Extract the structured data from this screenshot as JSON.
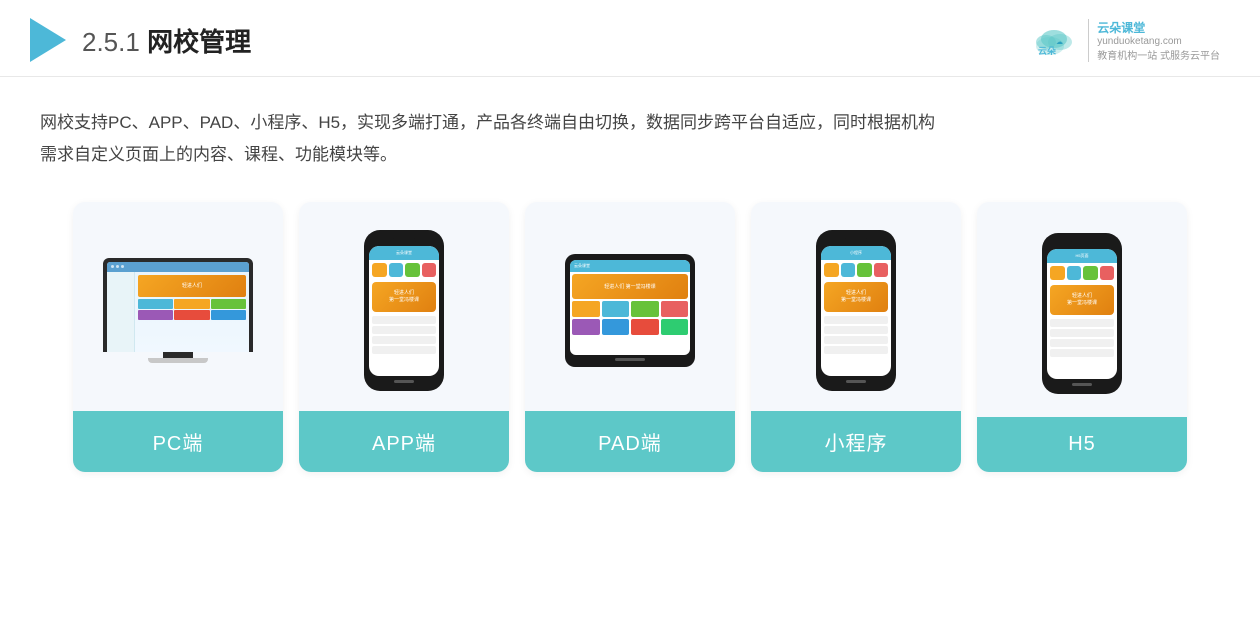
{
  "header": {
    "title_number": "2.5.1",
    "title_text": "网校管理",
    "brand": {
      "name": "云朵课堂",
      "domain": "yunduoketang.com",
      "slogan1": "教育机构一站",
      "slogan2": "式服务云平台"
    }
  },
  "main": {
    "description_line1": "网校支持PC、APP、PAD、小程序、H5，实现多端打通，产品各终端自由切换，数据同步跨平台自适应，同时根据机构",
    "description_line2": "需求自定义页面上的内容、课程、功能模块等。"
  },
  "cards": [
    {
      "id": "pc",
      "label": "PC端"
    },
    {
      "id": "app",
      "label": "APP端"
    },
    {
      "id": "pad",
      "label": "PAD端"
    },
    {
      "id": "miniprogram",
      "label": "小程序"
    },
    {
      "id": "h5",
      "label": "H5"
    }
  ],
  "colors": {
    "teal": "#5dc8c8",
    "blue_accent": "#4db8d8",
    "orange": "#f5a623",
    "dark": "#1a1a1a",
    "card_bg": "#f5f8fc"
  }
}
